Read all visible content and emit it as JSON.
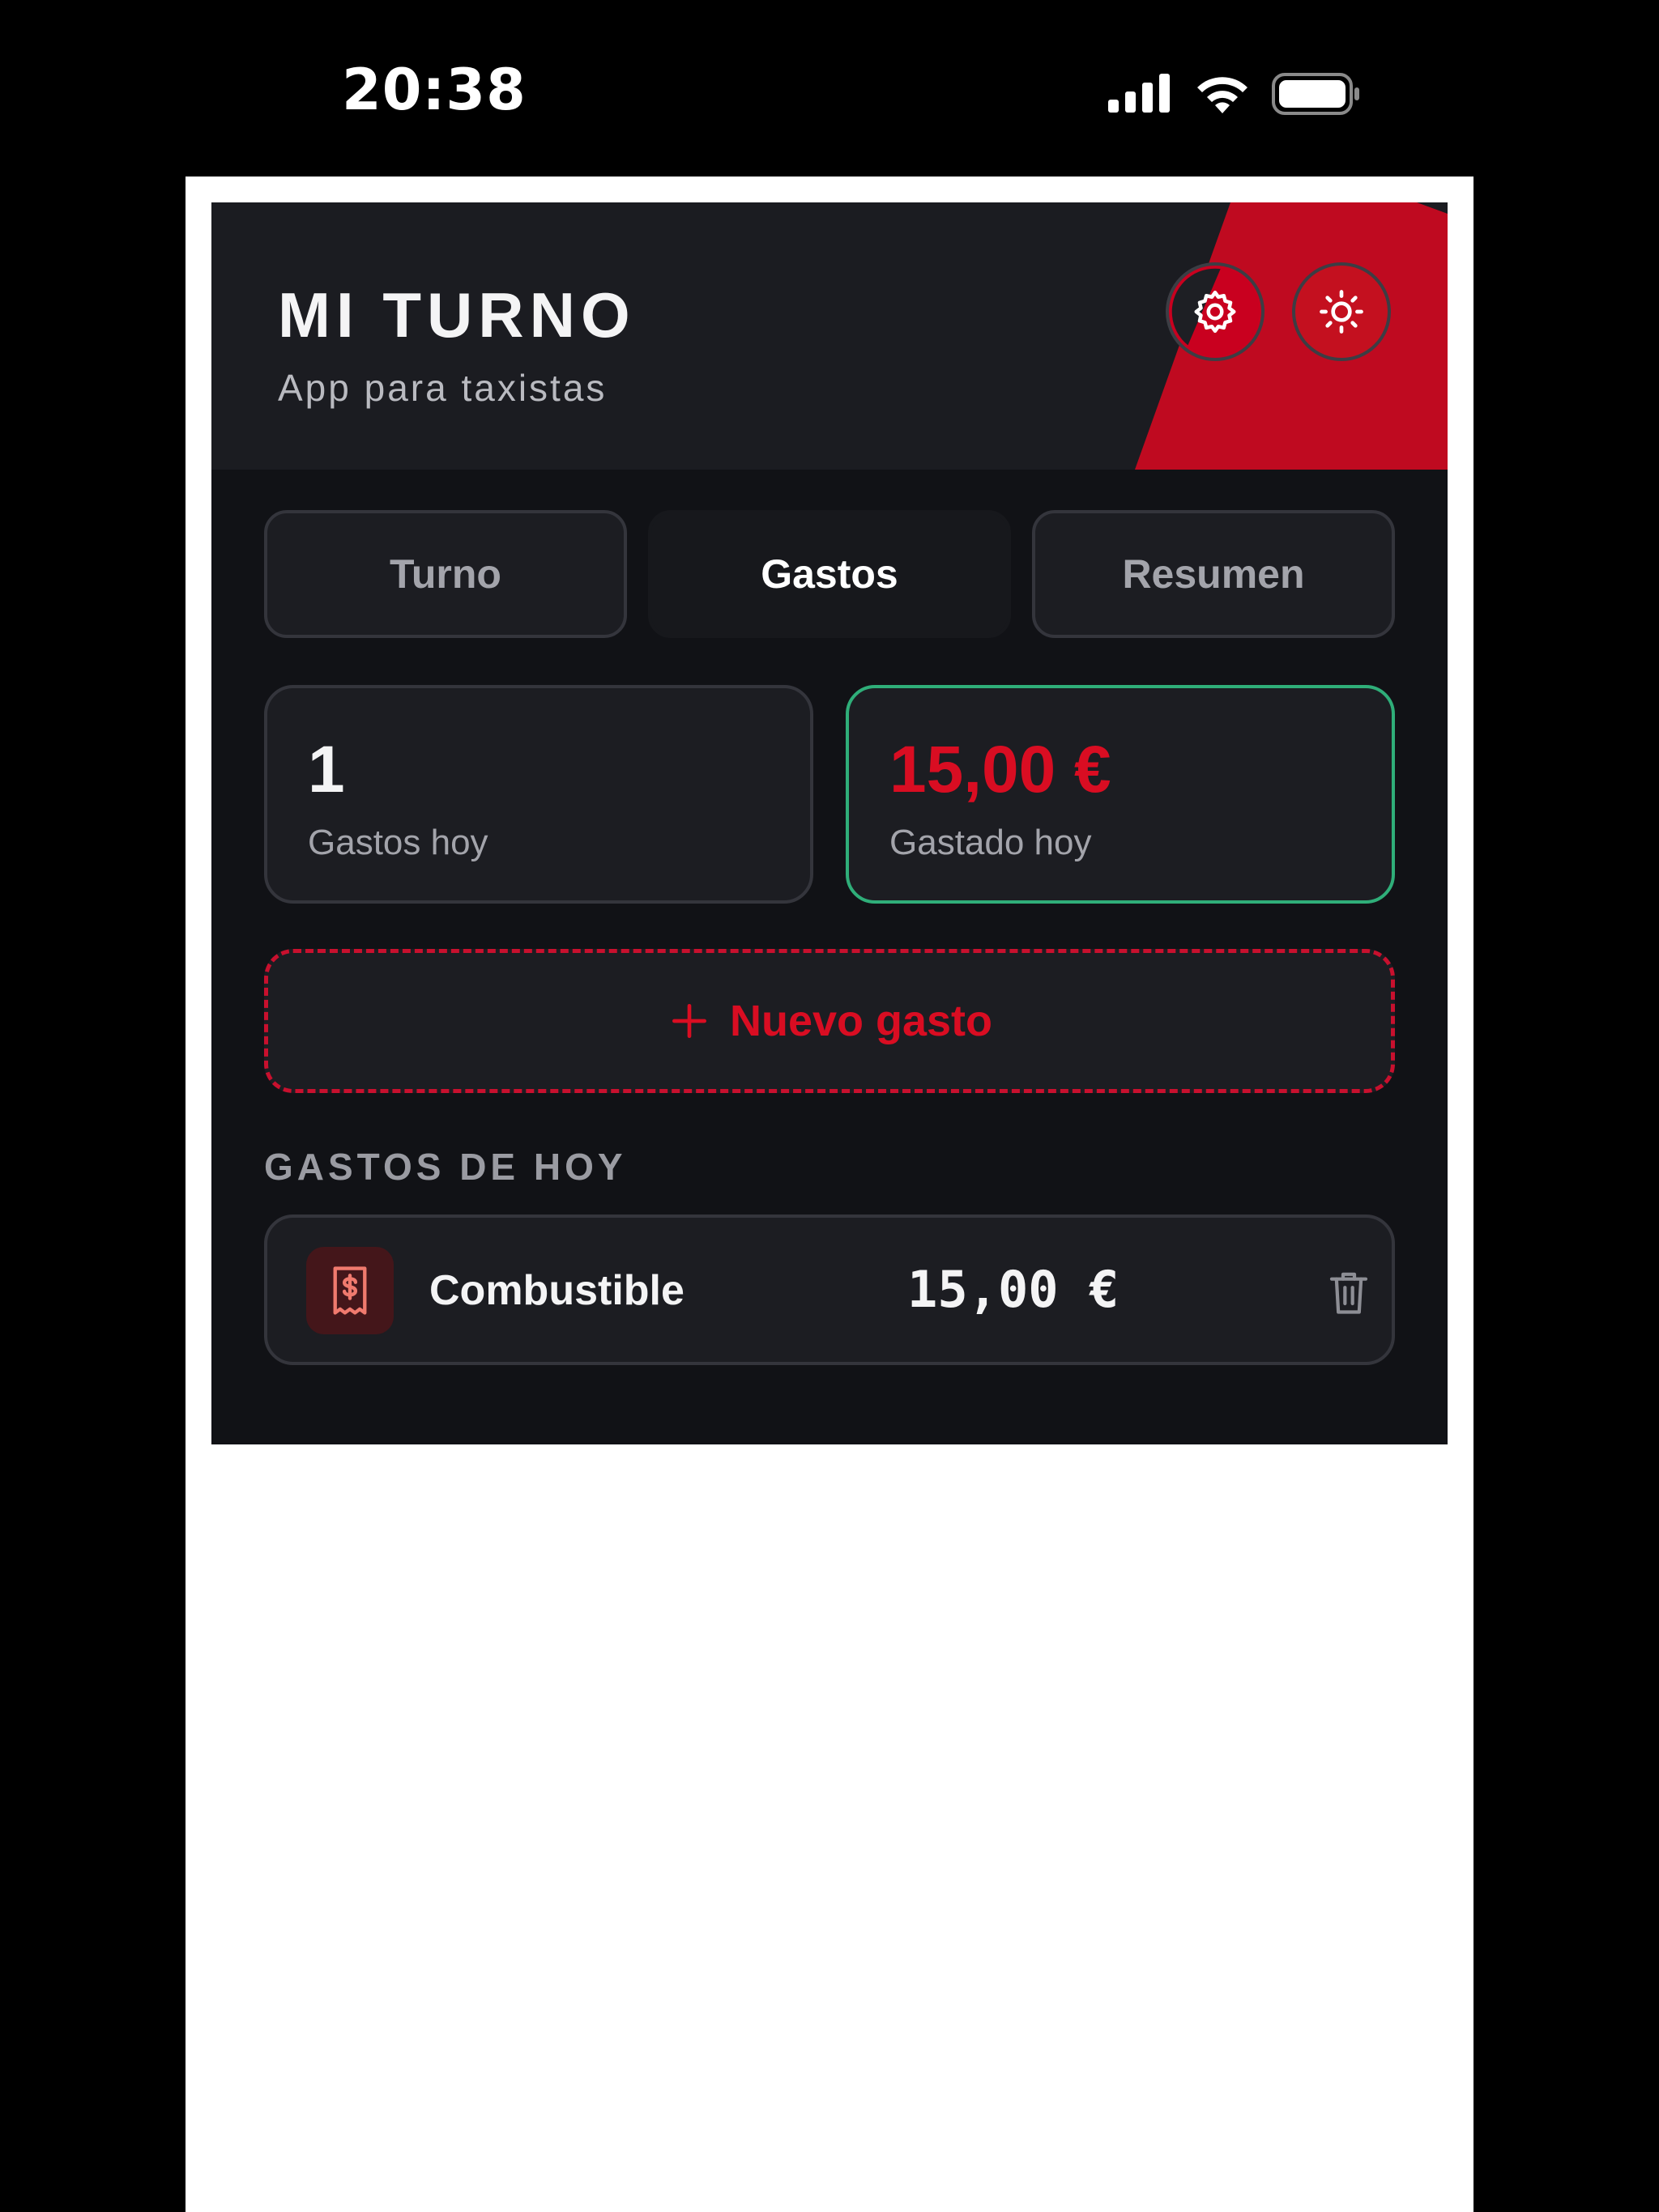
{
  "status_bar": {
    "time": "20:38",
    "icons": [
      "cellular-signal-icon",
      "wifi-icon",
      "battery-icon"
    ]
  },
  "header": {
    "title": "MI TURNO",
    "subtitle": "App para taxistas",
    "buttons": [
      "gear-icon",
      "sun-icon"
    ]
  },
  "tabs": [
    {
      "label": "Turno",
      "active": false
    },
    {
      "label": "Gastos",
      "active": true
    },
    {
      "label": "Resumen",
      "active": false
    }
  ],
  "stats": {
    "count": {
      "value": "1",
      "label": "Gastos hoy"
    },
    "spent": {
      "value": "15,00 €",
      "label": "Gastado hoy"
    }
  },
  "new_expense": {
    "label": "Nuevo gasto",
    "icon": "plus-icon"
  },
  "section_title": "GASTOS DE HOY",
  "expenses": [
    {
      "name": "Combustible",
      "amount": "15,00 €",
      "icon": "receipt-icon",
      "action_icon": "trash-icon"
    }
  ],
  "colors": {
    "accent": "#c8102e",
    "success_border": "#2fae79",
    "background": "#111216",
    "card": "#1c1d22"
  }
}
